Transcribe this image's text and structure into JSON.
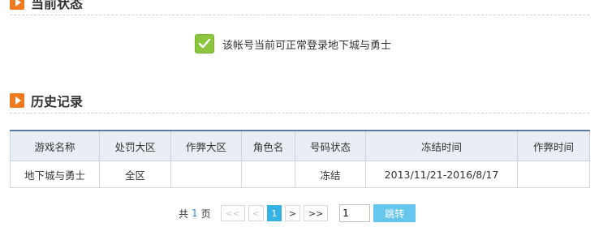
{
  "current_status": {
    "title": "当前状态",
    "message": "该帐号当前可正常登录地下城与勇士"
  },
  "history": {
    "title": "历史记录",
    "columns": [
      "游戏名称",
      "处罚大区",
      "作弊大区",
      "角色名",
      "号码状态",
      "冻结时间",
      "作弊时间"
    ],
    "rows": [
      [
        "地下城与勇士",
        "全区",
        "",
        "",
        "冻结",
        "2013/11/21-2016/8/17",
        ""
      ]
    ]
  },
  "pagination": {
    "total_prefix": "共",
    "total_pages": "1",
    "total_suffix": "页",
    "first": "<<",
    "prev": "<",
    "current": "1",
    "next": ">",
    "last": ">>",
    "input_value": "1",
    "jump_label": "跳转"
  },
  "colors": {
    "accent_orange": "#f07a1f",
    "check_green": "#8cc63e",
    "active_blue": "#35b3e6",
    "jump_blue": "#66c6ee"
  }
}
